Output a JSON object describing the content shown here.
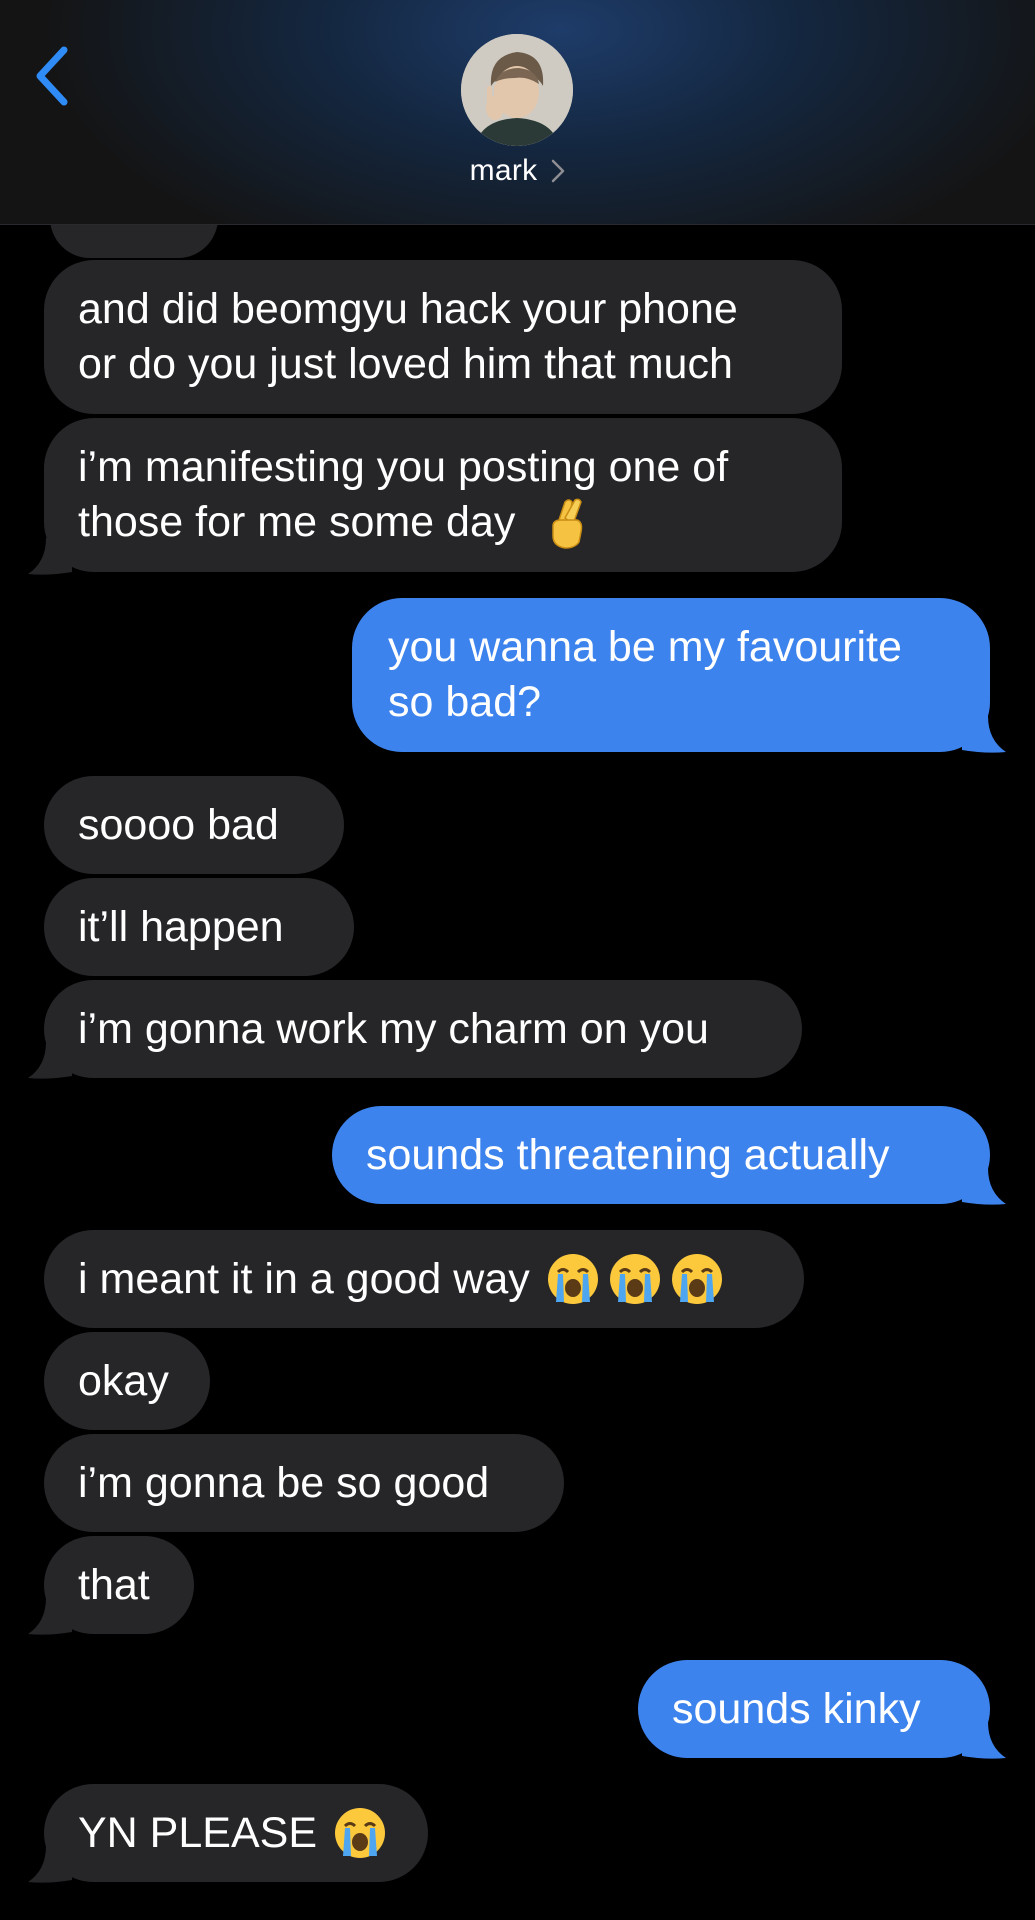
{
  "header": {
    "contact_name": "mark",
    "back_icon": "chevron-left-icon",
    "details_icon": "chevron-right-icon"
  },
  "colors": {
    "accent": "#3d83ee",
    "received_bubble": "#262629",
    "background": "#000000"
  },
  "messages": [
    {
      "from": "them",
      "lines": [
        "and did beomgyu hack your phone",
        "or do you just loved him that much"
      ]
    },
    {
      "from": "them",
      "lines": [
        "i’m manifesting you posting one of",
        "those for me some day"
      ],
      "emoji": "crossed-fingers"
    },
    {
      "from": "me",
      "lines": [
        "you wanna be my favourite",
        "so bad?"
      ]
    },
    {
      "from": "them",
      "lines": [
        "soooo bad"
      ]
    },
    {
      "from": "them",
      "lines": [
        "it’ll happen"
      ]
    },
    {
      "from": "them",
      "lines": [
        "i’m gonna work my charm on you"
      ]
    },
    {
      "from": "me",
      "lines": [
        "sounds threatening actually"
      ]
    },
    {
      "from": "them",
      "lines": [
        "i meant it in a good way"
      ],
      "emoji": "loudly-crying-face x3"
    },
    {
      "from": "them",
      "lines": [
        "okay"
      ]
    },
    {
      "from": "them",
      "lines": [
        "i’m gonna be so good"
      ]
    },
    {
      "from": "them",
      "lines": [
        "that"
      ]
    },
    {
      "from": "me",
      "lines": [
        "sounds kinky"
      ]
    },
    {
      "from": "them",
      "lines": [
        "YN PLEASE"
      ],
      "emoji": "loudly-crying-face"
    }
  ]
}
